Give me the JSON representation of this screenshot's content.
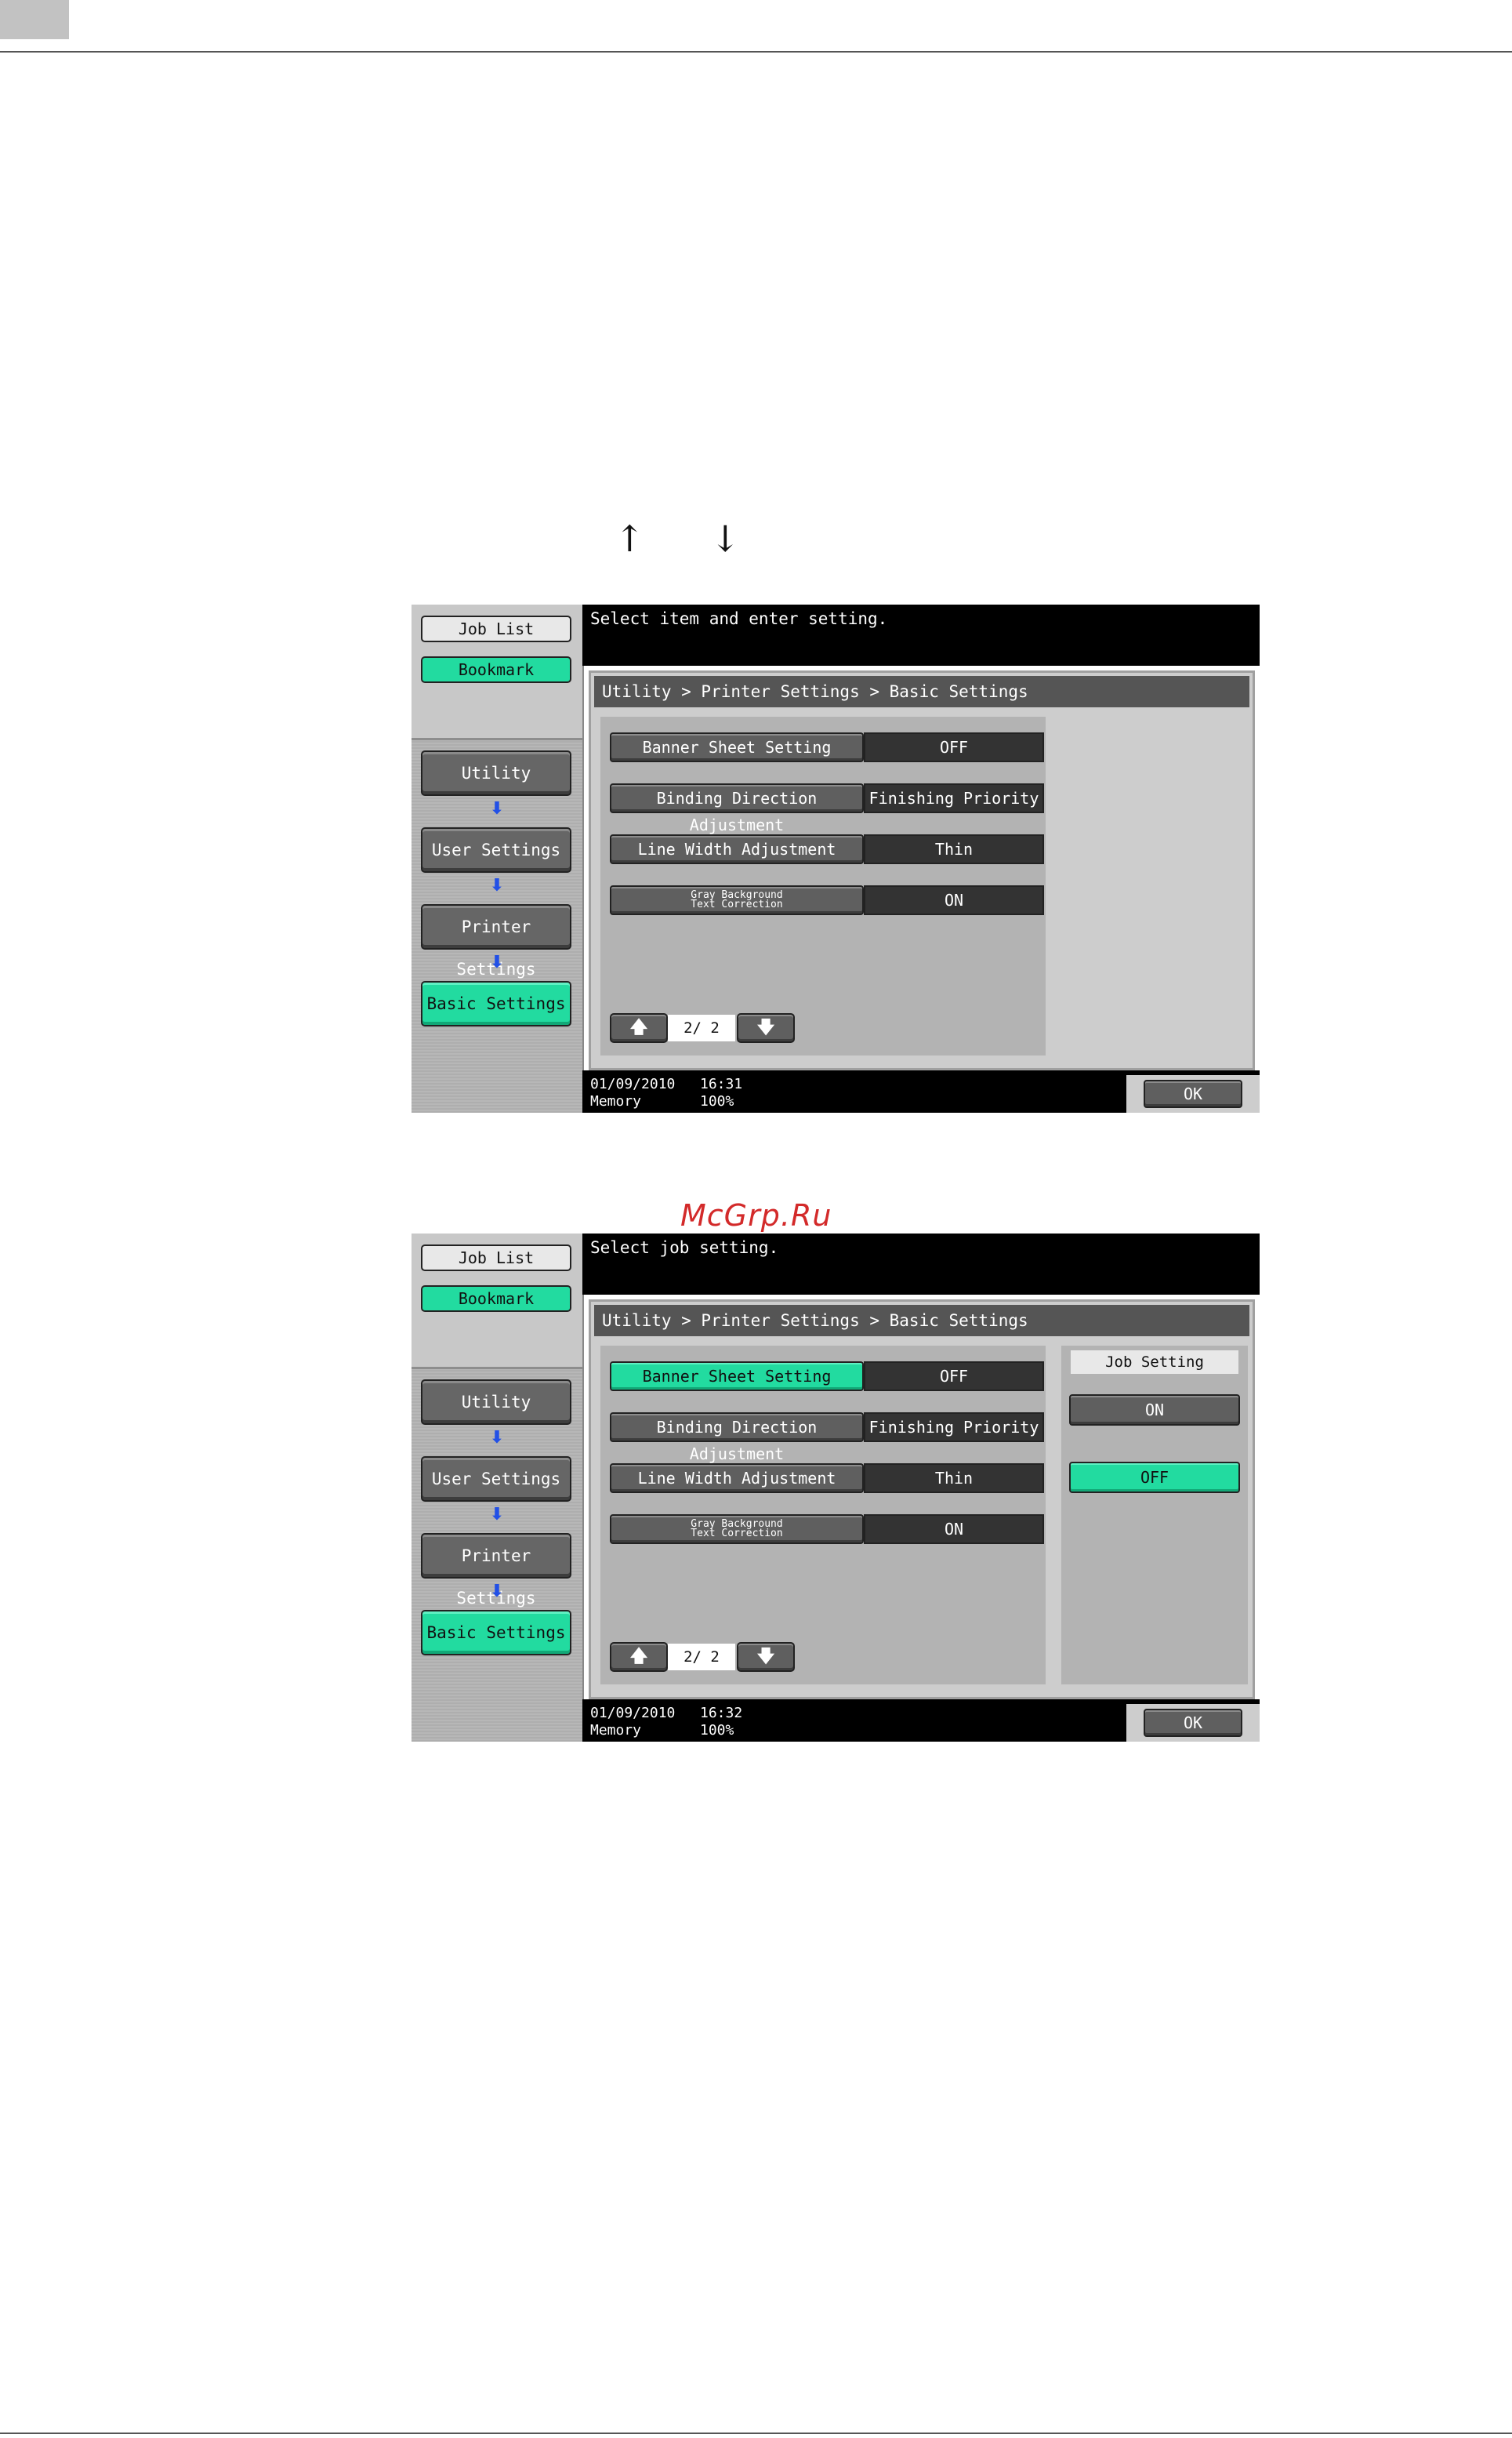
{
  "page": {
    "arrow_up": "↑",
    "arrow_down": "↓",
    "watermark": "McGrp.Ru"
  },
  "screens": [
    {
      "message": "Select item and enter setting.",
      "sidebar": {
        "job_list": "Job List",
        "bookmark": "Bookmark",
        "utility": "Utility",
        "user_settings": "User Settings",
        "printer_settings": "Printer Settings",
        "basic_settings": "Basic Settings"
      },
      "breadcrumb": "Utility > Printer Settings > Basic Settings",
      "rows": [
        {
          "label": "Banner Sheet Setting",
          "value": "OFF"
        },
        {
          "label": "Binding Direction Adjustment",
          "value": "Finishing Priority"
        },
        {
          "label": "Line Width Adjustment",
          "value": "Thin"
        },
        {
          "label_line1": "Gray Background",
          "label_line2": "Text Correction",
          "value": "ON"
        }
      ],
      "pager": {
        "up": "🡅",
        "count": "2/ 2",
        "down": "🡇"
      },
      "status": {
        "date": "01/09/2010",
        "time": "16:31",
        "memory_label": "Memory",
        "memory_value": "100%"
      },
      "ok": "OK"
    },
    {
      "message": "Select job setting.",
      "sidebar": {
        "job_list": "Job List",
        "bookmark": "Bookmark",
        "utility": "Utility",
        "user_settings": "User Settings",
        "printer_settings": "Printer Settings",
        "basic_settings": "Basic Settings"
      },
      "breadcrumb": "Utility > Printer Settings > Basic Settings",
      "rows": [
        {
          "label": "Banner Sheet Setting",
          "value": "OFF"
        },
        {
          "label": "Binding Direction Adjustment",
          "value": "Finishing Priority"
        },
        {
          "label": "Line Width Adjustment",
          "value": "Thin"
        },
        {
          "label_line1": "Gray Background",
          "label_line2": "Text Correction",
          "value": "ON"
        }
      ],
      "pager": {
        "up": "🡅",
        "count": "2/ 2",
        "down": "🡇"
      },
      "job_setting": {
        "title": "Job Setting",
        "on": "ON",
        "off": "OFF"
      },
      "status": {
        "date": "01/09/2010",
        "time": "16:32",
        "memory_label": "Memory",
        "memory_value": "100%"
      },
      "ok": "OK"
    }
  ],
  "colors": {
    "selected_green": "#22dba0",
    "flow_arrow_blue": "#2250e6",
    "button_gray": "#5f5f5f",
    "watermark_red": "#d32a2a"
  }
}
